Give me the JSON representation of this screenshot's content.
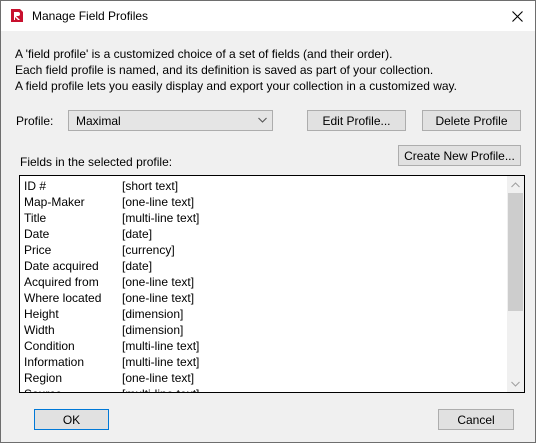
{
  "window": {
    "title": "Manage Field Profiles"
  },
  "description": {
    "line1": "A 'field profile' is a customized choice of a set of fields (and their order).",
    "line2": "Each field profile is named, and its definition is saved as part of your collection.",
    "line3": "A field profile lets you easily display and export your collection in a customized way."
  },
  "profile": {
    "label": "Profile:",
    "selected": "Maximal"
  },
  "buttons": {
    "edit": "Edit Profile...",
    "delete": "Delete Profile",
    "create": "Create New Profile...",
    "ok": "OK",
    "cancel": "Cancel"
  },
  "fields_label": "Fields in the selected profile:",
  "fields": [
    {
      "name": "ID #",
      "type": "[short text]"
    },
    {
      "name": "Map-Maker",
      "type": "[one-line text]"
    },
    {
      "name": "Title",
      "type": "[multi-line text]"
    },
    {
      "name": "Date",
      "type": "[date]"
    },
    {
      "name": "Price",
      "type": "[currency]"
    },
    {
      "name": "Date acquired",
      "type": "[date]"
    },
    {
      "name": "Acquired from",
      "type": "[one-line text]"
    },
    {
      "name": "Where located",
      "type": "[one-line text]"
    },
    {
      "name": "Height",
      "type": "[dimension]"
    },
    {
      "name": "Width",
      "type": "[dimension]"
    },
    {
      "name": "Condition",
      "type": "[multi-line text]"
    },
    {
      "name": "Information",
      "type": "[multi-line text]"
    },
    {
      "name": "Region",
      "type": "[one-line text]"
    },
    {
      "name": "Source",
      "type": "[multi-line text]"
    }
  ],
  "icons": {
    "app": "app-logo-icon",
    "close": "close-icon",
    "dropdown": "chevron-down-icon",
    "scroll_up": "chevron-up-icon",
    "scroll_down": "chevron-down-icon"
  },
  "colors": {
    "accent": "#0078d7",
    "app_icon": "#c8102e"
  }
}
